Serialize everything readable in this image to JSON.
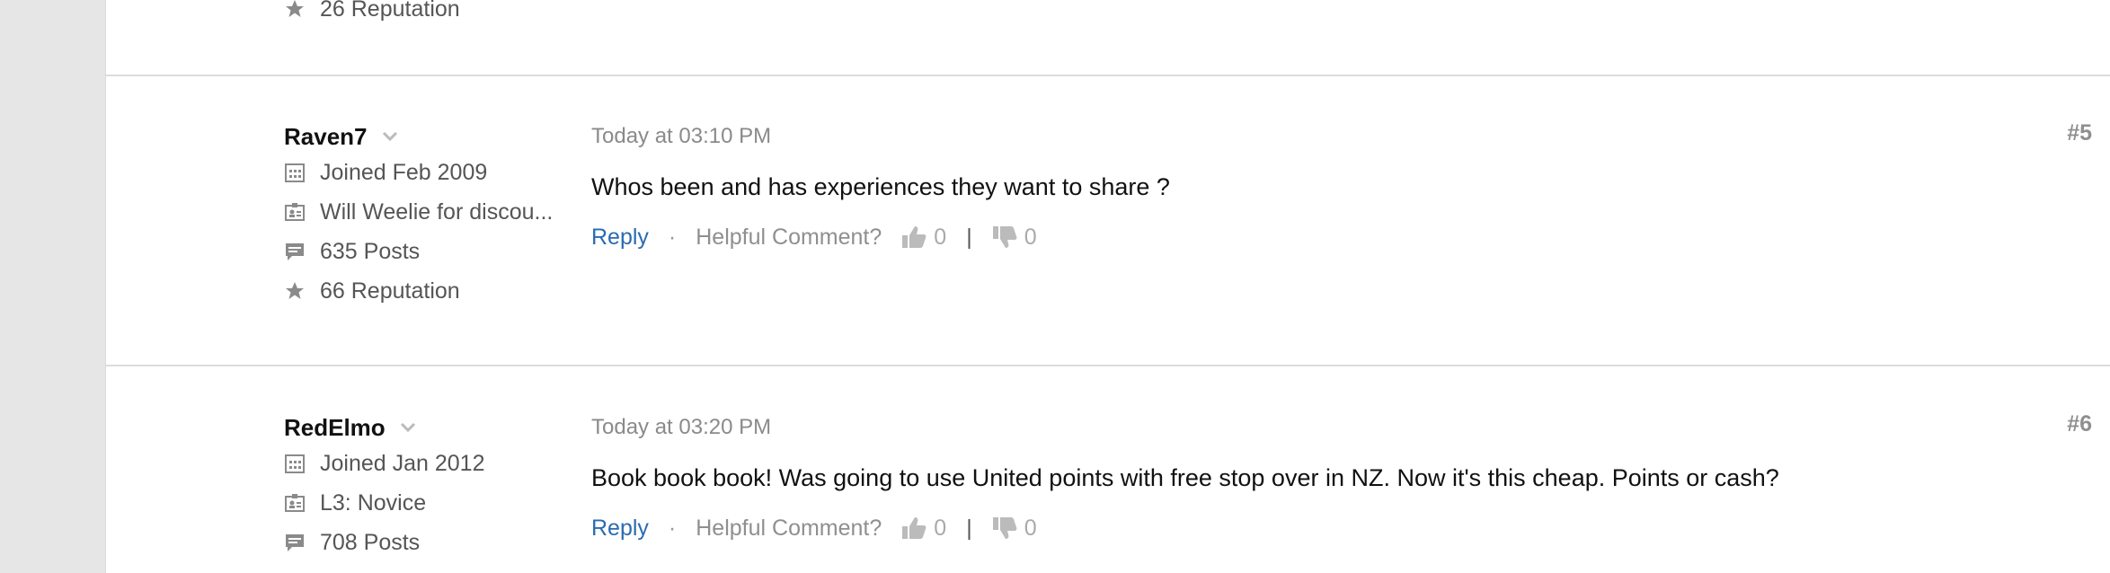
{
  "previous_comment": {
    "reputation": "26 Reputation"
  },
  "comments": [
    {
      "username": "Raven7",
      "joined": "Joined Feb 2009",
      "title": "Will Weelie for discou...",
      "posts": "635 Posts",
      "reputation": "66 Reputation",
      "timestamp": "Today at 03:10 PM",
      "body": "Whos been and has experiences they want to share ?",
      "reply": "Reply",
      "helpful": "Helpful Comment?",
      "upvotes": "0",
      "downvotes": "0",
      "separator": "|",
      "post_number": "#5"
    },
    {
      "username": "RedElmo",
      "joined": "Joined Jan 2012",
      "title": "L3: Novice",
      "posts": "708 Posts",
      "timestamp": "Today at 03:20 PM",
      "body": "Book book book! Was going to use United points with free stop over in NZ. Now it's this cheap. Points or cash?",
      "reply": "Reply",
      "helpful": "Helpful Comment?",
      "upvotes": "0",
      "downvotes": "0",
      "separator": "|",
      "post_number": "#6"
    }
  ],
  "icons": {
    "calendar": "calendar-icon",
    "badge": "id-badge-icon",
    "posts": "speech-bubble-icon",
    "reputation": "star-icon",
    "chevron": "chevron-down-icon",
    "thumbs_up": "thumbs-up-icon",
    "thumbs_down": "thumbs-down-icon"
  },
  "colors": {
    "link": "#2a6bb0",
    "muted": "#8f8f8f",
    "gutter": "#e6e6e6",
    "divider": "#dcdcdc"
  }
}
